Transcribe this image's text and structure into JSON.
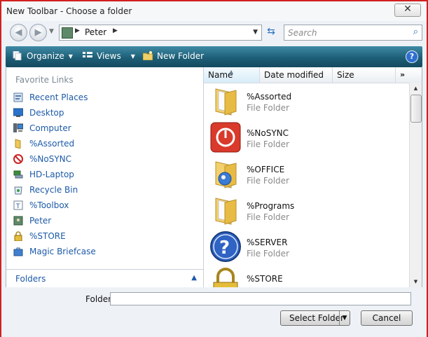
{
  "window": {
    "title": "New Toolbar - Choose a folder",
    "close_glyph": "✕"
  },
  "address": {
    "back_glyph": "◀",
    "forward_glyph": "▶",
    "crumb_icon": "folder-icon",
    "path": "Peter",
    "search_placeholder": "Search"
  },
  "toolbar": {
    "organize_label": "Organize",
    "views_label": "Views",
    "new_folder_label": "New Folder",
    "help_glyph": "?",
    "bg_color": "#1d5f77"
  },
  "nav": {
    "favorites_header": "Favorite Links",
    "favorites": [
      {
        "label": "Recent Places",
        "icon": "recent-places-icon"
      },
      {
        "label": "Desktop",
        "icon": "desktop-icon"
      },
      {
        "label": "Computer",
        "icon": "computer-icon"
      },
      {
        "label": "%Assorted",
        "icon": "folder-icon"
      },
      {
        "label": "%NoSYNC",
        "icon": "nosync-icon"
      },
      {
        "label": "HD-Laptop",
        "icon": "network-drive-icon"
      },
      {
        "label": "Recycle Bin",
        "icon": "recycle-bin-icon"
      },
      {
        "label": "%Toolbox",
        "icon": "toolbox-icon"
      },
      {
        "label": "Peter",
        "icon": "user-folder-icon"
      },
      {
        "label": "%STORE",
        "icon": "lock-icon"
      },
      {
        "label": "Magic Briefcase",
        "icon": "briefcase-icon"
      }
    ],
    "folders_label": "Folders"
  },
  "columns": {
    "name": "Name",
    "date": "Date modified",
    "size": "Size",
    "more": "»"
  },
  "files": [
    {
      "name": "%Assorted",
      "type": "File Folder",
      "icon": "folder-icon"
    },
    {
      "name": "%NoSYNC",
      "type": "File Folder",
      "icon": "power-icon"
    },
    {
      "name": "%OFFICE",
      "type": "File Folder",
      "icon": "office-folder-icon"
    },
    {
      "name": "%Programs",
      "type": "File Folder",
      "icon": "folder-icon"
    },
    {
      "name": "%SERVER",
      "type": "File Folder",
      "icon": "question-icon"
    },
    {
      "name": "%STORE",
      "type": "",
      "icon": "padlock-icon"
    }
  ],
  "footer": {
    "folder_label": "Folder:",
    "folder_value": "",
    "select_label": "Select Folder",
    "cancel_label": "Cancel"
  },
  "colors": {
    "link": "#1c5aa8",
    "accent_border": "#d21f1f"
  }
}
